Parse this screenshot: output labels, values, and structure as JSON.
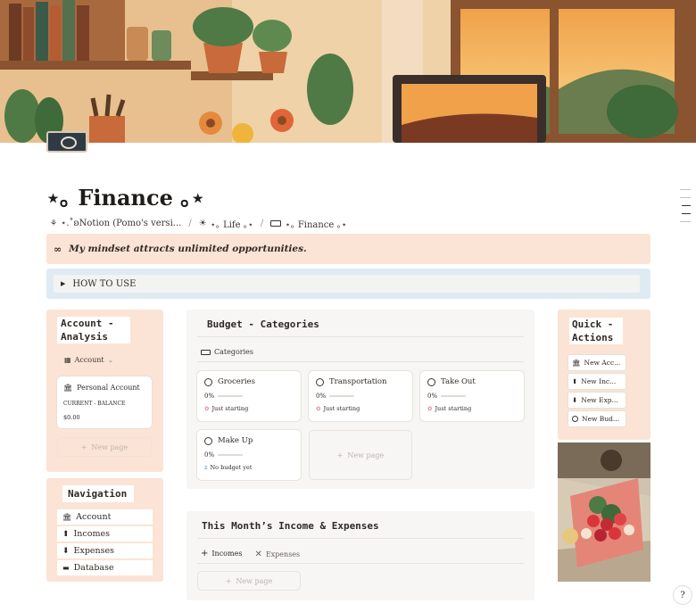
{
  "page": {
    "title": "⋆｡ Finance ｡⋆",
    "breadcrumb": [
      "⋆.˚ʚNotion (Pomo's versi...",
      "⋆｡ Life ｡⋆",
      "⋆｡ Finance ｡⋆"
    ],
    "quote": "My mindset attracts unlimited opportunities.",
    "toggle_label": "HOW TO USE"
  },
  "account": {
    "heading": "Account - Analysis",
    "filter_label": "Account",
    "card_title": "Personal Account",
    "property_label": "CURRENT - BALANCE",
    "balance": "$0.00",
    "new_page": "New page"
  },
  "navigation": {
    "heading": "Navigation",
    "items": [
      {
        "label": "Account",
        "icon": "bank-icon"
      },
      {
        "label": "Incomes",
        "icon": "arrow-up-circle-icon"
      },
      {
        "label": "Expenses",
        "icon": "arrow-down-circle-icon"
      },
      {
        "label": "Database",
        "icon": "archive-icon"
      }
    ]
  },
  "budget": {
    "heading": "Budget - Categories",
    "view_label": "Categories",
    "new_page": "New page",
    "cards": [
      {
        "name": "Groceries",
        "percent": "0%",
        "progress": 0,
        "status": "Just starting",
        "status_icon": "flower-icon"
      },
      {
        "name": "Transportation",
        "percent": "0%",
        "progress": 0,
        "status": "Just starting",
        "status_icon": "flower-icon"
      },
      {
        "name": "Take Out",
        "percent": "0%",
        "progress": 0,
        "status": "Just starting",
        "status_icon": "flower-icon"
      },
      {
        "name": "Make Up",
        "percent": "0%",
        "progress": 0,
        "status": "No budget yet",
        "status_icon": "sleep-icon"
      }
    ]
  },
  "monthly": {
    "heading": "This Month’s Income & Expenses",
    "tabs": [
      "Incomes",
      "Expenses"
    ],
    "active_tab": "Incomes",
    "new_page": "New page"
  },
  "quick_actions": {
    "heading": "Quick - Actions",
    "items": [
      {
        "label": "New Acc...",
        "icon": "bank-icon"
      },
      {
        "label": "New Inc...",
        "icon": "arrow-up-circle-icon"
      },
      {
        "label": "New Exp...",
        "icon": "arrow-down-circle-icon"
      },
      {
        "label": "New Bud...",
        "icon": "circle-icon"
      }
    ]
  },
  "colors": {
    "accent_peach": "#fbe4d5",
    "accent_blue": "#deebf3",
    "panel_gray": "#f7f6f4",
    "progress": "#c25a3b"
  }
}
